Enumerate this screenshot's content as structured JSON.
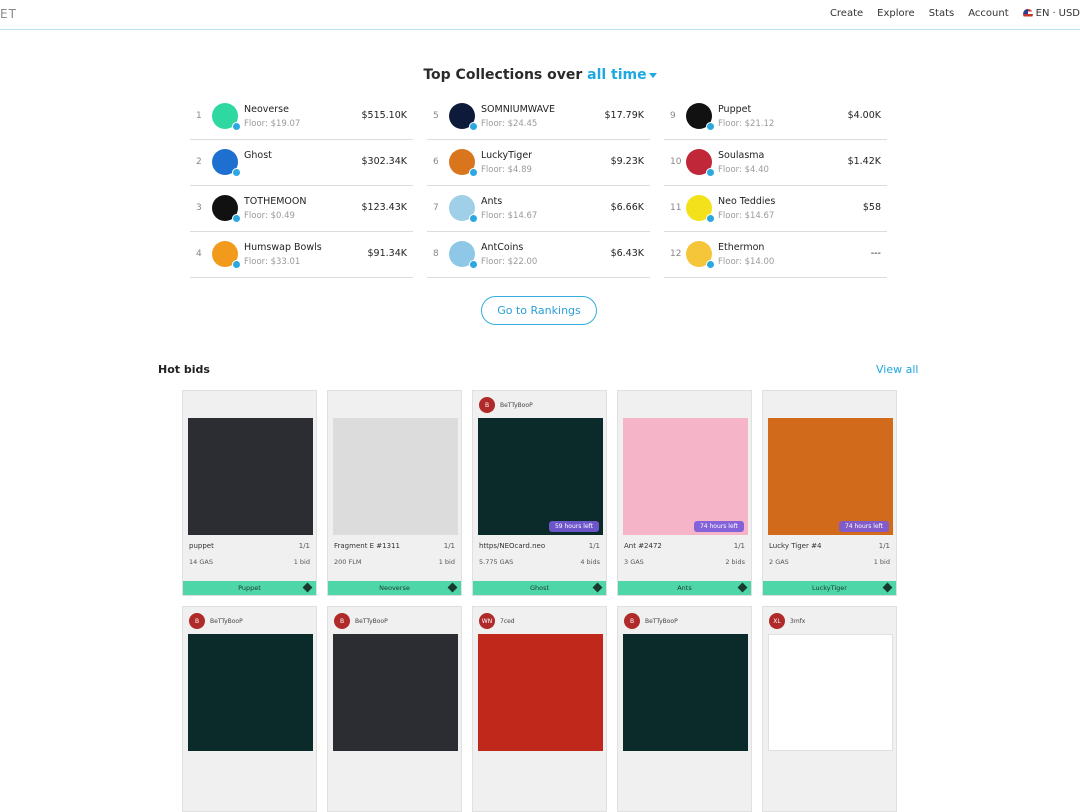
{
  "header": {
    "brand": "ET",
    "nav": [
      "Create",
      "Explore",
      "Stats",
      "Account"
    ],
    "language": "EN",
    "currency": "USD"
  },
  "top": {
    "title_prefix": "Top Collections over",
    "period": "all time",
    "collections": [
      {
        "rank": "1",
        "name": "Neoverse",
        "floor": "Floor: $19.07",
        "volume": "$515.10K",
        "color": "#2fd8a0"
      },
      {
        "rank": "2",
        "name": "Ghost",
        "floor": "",
        "volume": "$302.34K",
        "color": "#1f6fd0"
      },
      {
        "rank": "3",
        "name": "TOTHEMOON",
        "floor": "Floor: $0.49",
        "volume": "$123.43K",
        "color": "#111111"
      },
      {
        "rank": "4",
        "name": "Humswap Bowls",
        "floor": "Floor: $33.01",
        "volume": "$91.34K",
        "color": "#f29a1c"
      },
      {
        "rank": "5",
        "name": "SOMNIUMWAVE",
        "floor": "Floor: $24.45",
        "volume": "$17.79K",
        "color": "#0d1a3a"
      },
      {
        "rank": "6",
        "name": "LuckyTiger",
        "floor": "Floor: $4.89",
        "volume": "$9.23K",
        "color": "#d9751c"
      },
      {
        "rank": "7",
        "name": "Ants",
        "floor": "Floor: $14.67",
        "volume": "$6.66K",
        "color": "#9fd0e8"
      },
      {
        "rank": "8",
        "name": "AntCoins",
        "floor": "Floor: $22.00",
        "volume": "$6.43K",
        "color": "#8ec8e6"
      },
      {
        "rank": "9",
        "name": "Puppet",
        "floor": "Floor: $21.12",
        "volume": "$4.00K",
        "color": "#111111"
      },
      {
        "rank": "10",
        "name": "Soulasma",
        "floor": "Floor: $4.40",
        "volume": "$1.42K",
        "color": "#c0283a"
      },
      {
        "rank": "11",
        "name": "Neo Teddies",
        "floor": "Floor: $14.67",
        "volume": "$58",
        "color": "#f3e21b"
      },
      {
        "rank": "12",
        "name": "Ethermon",
        "floor": "Floor: $14.00",
        "volume": "---",
        "color": "#f5c53a"
      }
    ],
    "rankings_button": "Go to Rankings"
  },
  "hot_bids": {
    "title": "Hot bids",
    "view_all": "View all",
    "cards": [
      {
        "owner": "",
        "title": "puppet",
        "edition": "1/1",
        "price": "14 GAS",
        "bids": "1 bid",
        "time": "",
        "collection": "Puppet",
        "art": "#2b2d33"
      },
      {
        "owner": "",
        "title": "Fragment E #1311",
        "edition": "1/1",
        "price": "200 FLM",
        "bids": "1 bid",
        "time": "",
        "collection": "Neoverse",
        "art": "#dcdcdc"
      },
      {
        "owner": "BeTTyBooP",
        "title": "https/NEOcard.neo",
        "edition": "1/1",
        "price": "5.775 GAS",
        "bids": "4 bids",
        "time": "59 hours left",
        "collection": "Ghost",
        "art": "#0b2a2a"
      },
      {
        "owner": "",
        "title": "Ant #2472",
        "edition": "1/1",
        "price": "3 GAS",
        "bids": "2 bids",
        "time": "74 hours left",
        "collection": "Ants",
        "art": "#f6b4c8"
      },
      {
        "owner": "",
        "title": "Lucky Tiger #4",
        "edition": "1/1",
        "price": "2 GAS",
        "bids": "1 bid",
        "time": "74 hours left",
        "collection": "LuckyTiger",
        "art": "#d26a1c"
      },
      {
        "owner": "BeTTyBooP",
        "title": "",
        "edition": "",
        "price": "",
        "bids": "",
        "time": "",
        "collection": "",
        "art": "#0b2a2a"
      },
      {
        "owner": "BeTTyBooP",
        "title": "",
        "edition": "",
        "price": "",
        "bids": "",
        "time": "",
        "collection": "",
        "art": "#2b2d33"
      },
      {
        "owner": "7ced",
        "title": "",
        "edition": "",
        "price": "",
        "bids": "",
        "time": "",
        "collection": "",
        "art": "#c0281c"
      },
      {
        "owner": "BeTTyBooP",
        "title": "",
        "edition": "",
        "price": "",
        "bids": "",
        "time": "",
        "collection": "",
        "art": "#0b2a2a"
      },
      {
        "owner": "3mfx",
        "title": "",
        "edition": "",
        "price": "",
        "bids": "",
        "time": "",
        "collection": "",
        "art": "#ffffff"
      }
    ],
    "owner_initials": [
      "",
      "",
      "B",
      "",
      "",
      "B",
      "B",
      "WN",
      "B",
      "XL"
    ]
  }
}
